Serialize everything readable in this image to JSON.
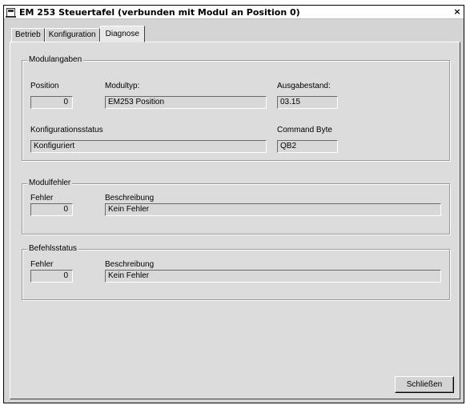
{
  "window": {
    "title": "EM 253 Steuertafel (verbunden mit Modul an Position 0)",
    "close_glyph": "×"
  },
  "tabs": [
    {
      "label": "Betrieb",
      "active": false
    },
    {
      "label": "Konfiguration",
      "active": false
    },
    {
      "label": "Diagnose",
      "active": true
    }
  ],
  "modulangaben": {
    "legend": "Modulangaben",
    "position_label": "Position",
    "position_value": "0",
    "modultyp_label": "Modultyp:",
    "modultyp_value": "EM253 Position",
    "ausgabestand_label": "Ausgabestand:",
    "ausgabestand_value": "03.15",
    "konfigstatus_label": "Konfigurationsstatus",
    "konfigstatus_value": "Konfiguriert",
    "command_byte_label": "Command Byte",
    "command_byte_value": "QB2"
  },
  "modulfehler": {
    "legend": "Modulfehler",
    "fehler_label": "Fehler",
    "fehler_value": "0",
    "beschreibung_label": "Beschreibung",
    "beschreibung_value": "Kein Fehler"
  },
  "befehlsstatus": {
    "legend": "Befehlsstatus",
    "fehler_label": "Fehler",
    "fehler_value": "0",
    "beschreibung_label": "Beschreibung",
    "beschreibung_value": "Kein Fehler"
  },
  "buttons": {
    "close_label": "Schließen"
  }
}
